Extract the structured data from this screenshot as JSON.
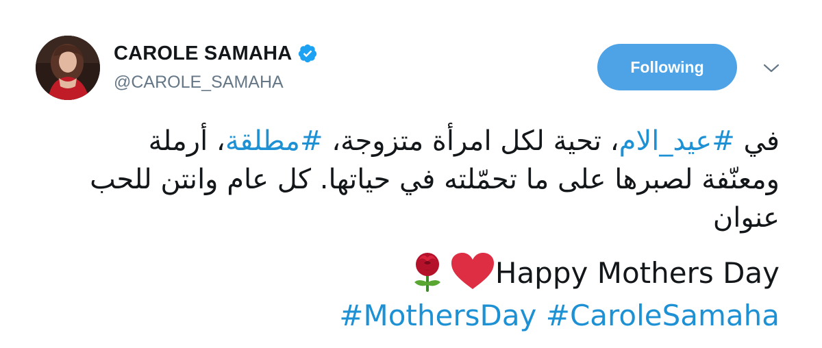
{
  "user": {
    "display_name": "CAROLE SAMAHA",
    "handle": "@CAROLE_SAMAHA",
    "verified": true
  },
  "follow_button": {
    "label": "Following"
  },
  "menu": {
    "icon": "chevron-down-icon"
  },
  "tweet": {
    "line1": {
      "prefix": "في ",
      "hashtag1": "#عيد_الام",
      "middle": "، تحية لكل امرأة متزوجة، ",
      "hashtag2": "#مطلقة",
      "suffix": "، أرملة"
    },
    "line2": "ومعنّفة لصبرها على ما تحمّلته في حياتها. كل عام وانتن للحب",
    "line3": "عنوان",
    "english": "Happy Mothers Day",
    "emojis": [
      "rose-icon",
      "heart-icon"
    ],
    "hashtags": [
      "#MothersDay",
      "#CaroleSamaha"
    ]
  },
  "colors": {
    "link": "#1d91d4",
    "button": "#4ea3e6",
    "handle": "#657786",
    "verified": "#1da1f2"
  }
}
